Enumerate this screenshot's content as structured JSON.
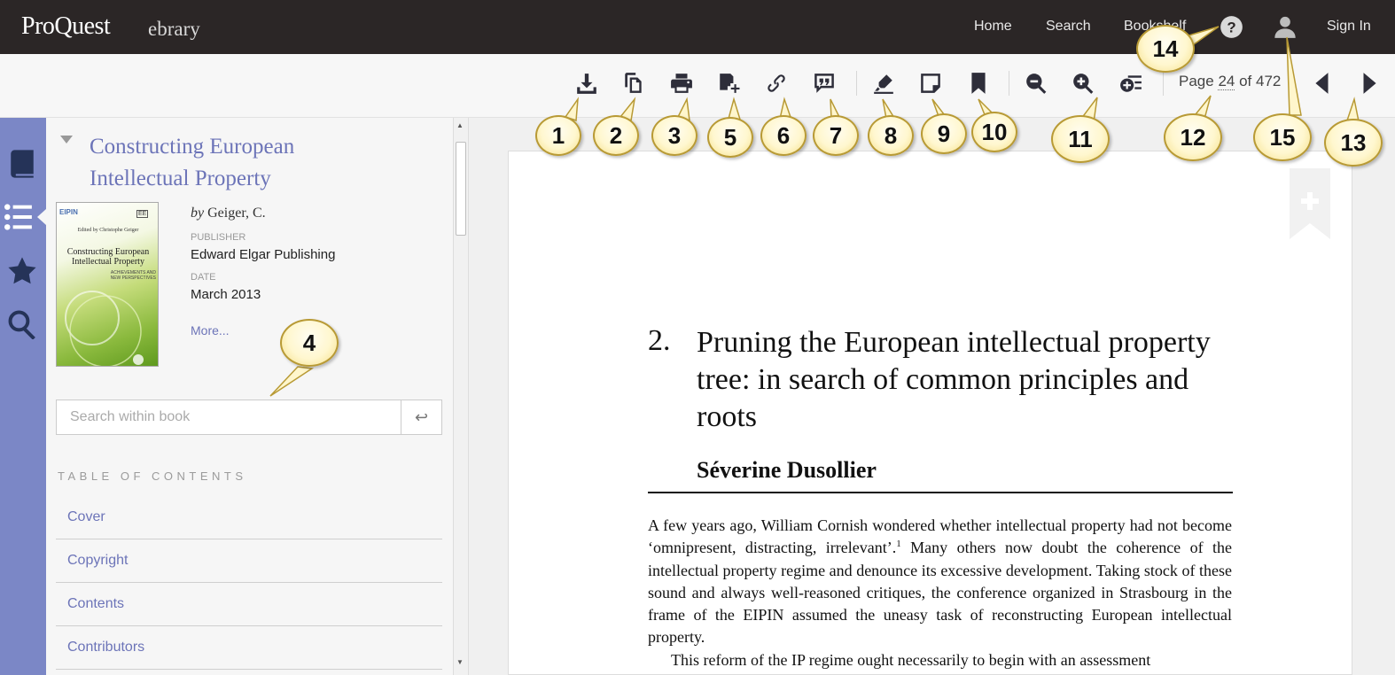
{
  "header": {
    "brand": "ProQuest",
    "product": "ebrary",
    "nav": [
      "Home",
      "Search",
      "Bookshelf",
      "Sign In"
    ],
    "icons": [
      "help-circle-icon",
      "user-icon"
    ]
  },
  "toolbar": {
    "icons": [
      "download-icon",
      "copy-icon",
      "print-icon",
      "add-to-folder-icon",
      "link-icon",
      "cite-icon",
      "highlight-icon",
      "note-icon",
      "bookmark-icon",
      "zoom-out-icon",
      "zoom-in-icon",
      "page-options-icon",
      "prev-page-icon",
      "next-page-icon"
    ],
    "page_prefix": "Page",
    "page_current": "24",
    "page_of": "of 472"
  },
  "rail": {
    "icons": [
      "book-icon",
      "list-icon",
      "star-icon",
      "search-icon"
    ],
    "active": "list-icon"
  },
  "book": {
    "title": "Constructing European Intellectual Property",
    "by_label": "by",
    "author": "Geiger, C.",
    "publisher_label": "PUBLISHER",
    "publisher": "Edward Elgar Publishing",
    "date_label": "DATE",
    "date": "March 2013",
    "more": "More...",
    "cover": {
      "editor": "Edited by Christophe Geiger",
      "title": "Constructing European Intellectual Property",
      "subtitle": "ACHIEVEMENTS AND NEW PERSPECTIVES",
      "logo": "EIPIN",
      "badge": "EE"
    }
  },
  "search": {
    "placeholder": "Search within book",
    "value": ""
  },
  "toc": {
    "heading": "TABLE OF CONTENTS",
    "items": [
      "Cover",
      "Copyright",
      "Contents",
      "Contributors"
    ]
  },
  "page": {
    "chapter_number": "2.",
    "chapter_title": "Pruning the European intellectual property tree: in search of common principles and roots",
    "author": "Séverine Dusollier",
    "paragraph_1a": "A few years ago, William Cornish wondered whether intellectual property had not become ‘omnipresent, distracting, irrelevant’.",
    "footnote_ref": "1",
    "paragraph_1b": " Many others now doubt the coherence of the intellectual property regime and denounce its excessive development. Taking stock of these sound and always well-reasoned critiques, the conference organized in Strasbourg in the frame of the EIPIN assumed the uneasy task of reconstructing European intellectual property.",
    "paragraph_2": "This reform of the IP regime ought necessarily to begin with an assessment"
  },
  "callouts": [
    "1",
    "2",
    "3",
    "4",
    "5",
    "6",
    "7",
    "8",
    "9",
    "10",
    "11",
    "12",
    "13",
    "14",
    "15"
  ]
}
